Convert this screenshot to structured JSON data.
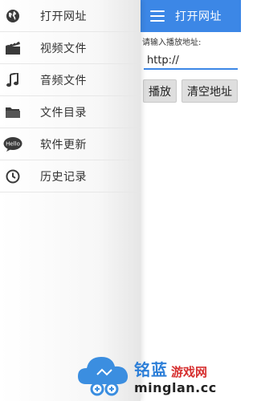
{
  "drawer": {
    "items": [
      {
        "label": "打开网址",
        "icon": "globe-icon"
      },
      {
        "label": "视频文件",
        "icon": "clapperboard-icon"
      },
      {
        "label": "音频文件",
        "icon": "music-note-icon"
      },
      {
        "label": "文件目录",
        "icon": "folder-icon"
      },
      {
        "label": "软件更新",
        "icon": "hello-bubble-icon"
      },
      {
        "label": "历史记录",
        "icon": "clock-icon"
      }
    ]
  },
  "appbar": {
    "title": "打开网址",
    "icon": "menu-icon"
  },
  "form": {
    "prompt": "请输入播放地址:",
    "url_value": "http://",
    "play_label": "播放",
    "clear_label": "清空地址"
  },
  "watermark": {
    "brand": "铭蓝",
    "sub": "游戏网",
    "domain": "minglan.cc",
    "hello_text": "Hello"
  },
  "colors": {
    "accent": "#3c87e6",
    "watermark_blue": "#2d7fd8",
    "watermark_red": "#d62f2f"
  }
}
